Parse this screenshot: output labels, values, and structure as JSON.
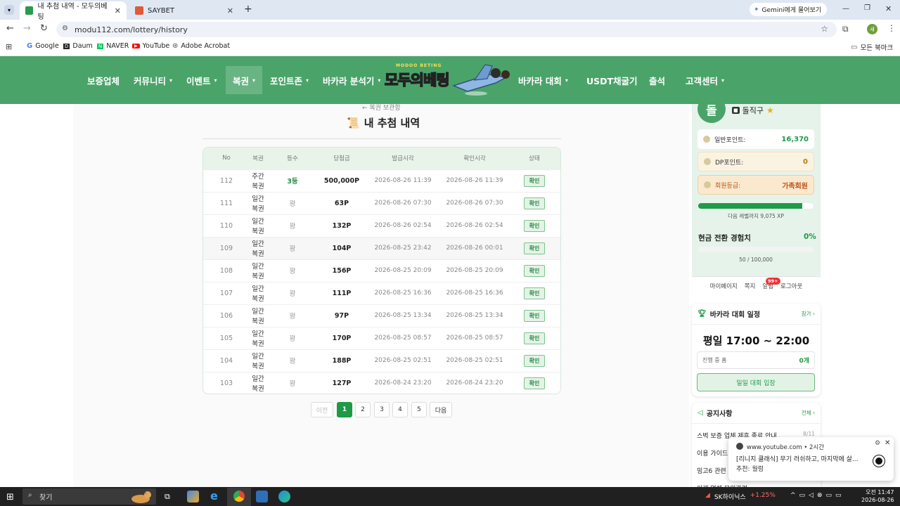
{
  "browser": {
    "tabs": [
      {
        "title": "내 추첨 내역 - 모두의베팅",
        "active": true
      },
      {
        "title": "SAYBET",
        "active": false
      }
    ],
    "new_tab": "+",
    "gemini_label": "Gemini에게 물어보기",
    "url": "modu112.com/lottery/history",
    "bookmarks": [
      "Google",
      "Daum",
      "NAVER",
      "YouTube",
      "Adobe Acrobat"
    ],
    "all_bookmarks": "모든 북마크",
    "profile_initial": "새"
  },
  "site": {
    "logo_text": "모두의베팅",
    "logo_sub": "MODOO BETING",
    "nav": [
      {
        "label": "보증업체",
        "dropdown": false
      },
      {
        "label": "커뮤니티",
        "dropdown": true
      },
      {
        "label": "이벤트",
        "dropdown": true
      },
      {
        "label": "복권",
        "dropdown": true
      },
      {
        "label": "포인트존",
        "dropdown": true
      },
      {
        "label": "바카라 분석기",
        "dropdown": true
      },
      {
        "label": "바카라 대회",
        "dropdown": true
      },
      {
        "label": "USDT채굴기",
        "dropdown": false
      },
      {
        "label": "출석",
        "dropdown": false
      },
      {
        "label": "고객센터",
        "dropdown": true
      }
    ]
  },
  "page": {
    "breadcrumb": "← 복권 보관함",
    "title": "내 추첨 내역",
    "columns": [
      "No",
      "복권",
      "등수",
      "당첨금",
      "발급시각",
      "확인시각",
      "상태"
    ],
    "rows": [
      {
        "no": "112",
        "type": "주간복권",
        "rank": "3등",
        "prize": "500,000P",
        "issued": "2026-08-26 11:39",
        "checked": "2026-08-26 11:39",
        "status": "확인"
      },
      {
        "no": "111",
        "type": "일간복권",
        "rank": "꽝",
        "prize": "63P",
        "issued": "2026-08-26 07:30",
        "checked": "2026-08-26 07:30",
        "status": "확인"
      },
      {
        "no": "110",
        "type": "일간복권",
        "rank": "꽝",
        "prize": "132P",
        "issued": "2026-08-26 02:54",
        "checked": "2026-08-26 02:54",
        "status": "확인"
      },
      {
        "no": "109",
        "type": "일간복권",
        "rank": "꽝",
        "prize": "104P",
        "issued": "2026-08-25 23:42",
        "checked": "2026-08-26 00:01",
        "status": "확인"
      },
      {
        "no": "108",
        "type": "일간복권",
        "rank": "꽝",
        "prize": "156P",
        "issued": "2026-08-25 20:09",
        "checked": "2026-08-25 20:09",
        "status": "확인"
      },
      {
        "no": "107",
        "type": "일간복권",
        "rank": "꽝",
        "prize": "111P",
        "issued": "2026-08-25 16:36",
        "checked": "2026-08-25 16:36",
        "status": "확인"
      },
      {
        "no": "106",
        "type": "일간복권",
        "rank": "꽝",
        "prize": "97P",
        "issued": "2026-08-25 13:34",
        "checked": "2026-08-25 13:34",
        "status": "확인"
      },
      {
        "no": "105",
        "type": "일간복권",
        "rank": "꽝",
        "prize": "170P",
        "issued": "2026-08-25 08:57",
        "checked": "2026-08-25 08:57",
        "status": "확인"
      },
      {
        "no": "104",
        "type": "일간복권",
        "rank": "꽝",
        "prize": "188P",
        "issued": "2026-08-25 02:51",
        "checked": "2026-08-25 02:51",
        "status": "확인"
      },
      {
        "no": "103",
        "type": "일간복권",
        "rank": "꽝",
        "prize": "127P",
        "issued": "2026-08-24 23:20",
        "checked": "2026-08-24 23:20",
        "status": "확인"
      }
    ],
    "pagination": {
      "prev": "이전",
      "pages": [
        "1",
        "2",
        "3",
        "4",
        "5"
      ],
      "current": "1",
      "next": "다음"
    }
  },
  "sidebar": {
    "profile": {
      "avatar": "돌",
      "name": "돌직구",
      "general_points_label": "일반포인트:",
      "general_points": "16,370",
      "dp_points_label": "DP포인트:",
      "dp_points": "0",
      "grade_label": "회원등급:",
      "grade": "가족회원",
      "xp_progress": 0.9,
      "xp_text": "다음 레벨까지 9,075 XP",
      "cash_label": "현금 전환 경험치",
      "cash_pct": "0%",
      "cash_progress": 0.0,
      "cash_text": "50 / 100,000",
      "links": [
        "마이페이지",
        "쪽지",
        "알림",
        "로그아웃"
      ],
      "notif_badge": "99+"
    },
    "baccarat": {
      "title": "바카라 대회 일정",
      "more": "참가 ›",
      "schedule_day": "평일",
      "schedule_time": "17:00 ~ 22:00",
      "progress_label": "진행 중 홈",
      "progress_value": "0개",
      "button": "일일 대회 입장"
    },
    "notices": {
      "title": "공지사항",
      "more": "전체 ›",
      "items": [
        {
          "text": "스벅 보증 업체 제휴 종료 안내",
          "date": "8/11"
        },
        {
          "text": "이용 가이드",
          "date": ""
        },
        {
          "text": "밍고6 관련 안",
          "date": ""
        },
        {
          "text": "이캐 업체 모의관련",
          "date": ""
        }
      ]
    }
  },
  "toast": {
    "source": "www.youtube.com",
    "time": "• 2시간",
    "text": "[리니지 클래식] 무기 러쉬하고, 마지막에 살...",
    "sub": "추천: 월렁"
  },
  "taskbar": {
    "search": "찾기",
    "stock_name": "SK하이닉스",
    "stock_change": "+1.25%",
    "time": "오전 11:47",
    "date": "2026-08-26"
  },
  "colors": {
    "brand": "#4aa46a",
    "accent": "#1e9a47"
  }
}
